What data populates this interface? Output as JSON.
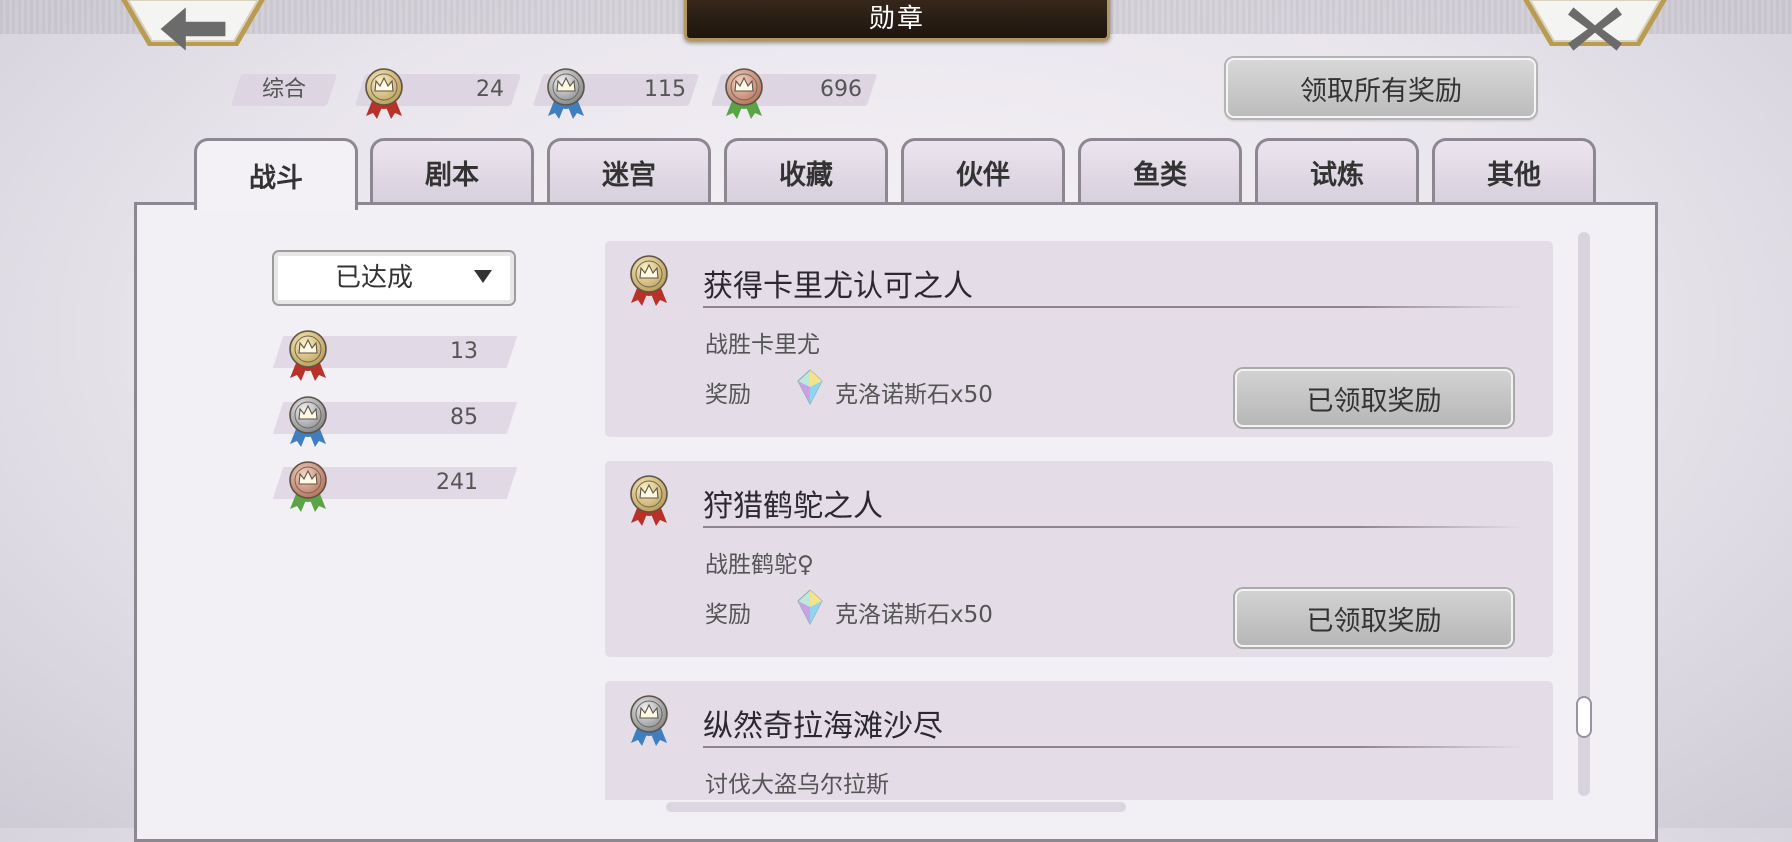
{
  "header": {
    "title": "勋章",
    "back_glyph": "🡐",
    "close_glyph": "✕"
  },
  "summary": {
    "label": "综合",
    "gold_count": "24",
    "silver_count": "115",
    "bronze_count": "696"
  },
  "claim_all_label": "领取所有奖励",
  "tabs": [
    {
      "label": "战斗",
      "active": true
    },
    {
      "label": "剧本"
    },
    {
      "label": "迷宫"
    },
    {
      "label": "收藏"
    },
    {
      "label": "伙伴"
    },
    {
      "label": "鱼类"
    },
    {
      "label": "试炼"
    },
    {
      "label": "其他"
    }
  ],
  "filter": {
    "selected": "已达成"
  },
  "category_counts": {
    "gold": "13",
    "silver": "85",
    "bronze": "241"
  },
  "reward_label": "奖励",
  "achievements": [
    {
      "medal": "gold",
      "title": "获得卡里尤认可之人",
      "description": "战胜卡里尤",
      "reward": "克洛诺斯石x50",
      "button": "已领取奖励"
    },
    {
      "medal": "gold",
      "title": "狩猎鹤鸵之人",
      "description": "战胜鹤鸵♀",
      "reward": "克洛诺斯石x50",
      "button": "已领取奖励"
    },
    {
      "medal": "silver",
      "title": "纵然奇拉海滩沙尽",
      "description": "讨伐大盗乌尔拉斯"
    }
  ],
  "colors": {
    "gold_medal": "#d8c07a",
    "silver_medal": "#a7a9ad",
    "bronze_medal": "#d6a089",
    "red_ribbon": "#b8322a",
    "blue_ribbon": "#3f7fc0",
    "green_ribbon": "#5aa446",
    "panel_border": "#8c8790",
    "title_plate": "#2a1d13"
  },
  "icons": {
    "back": "arrow-left-icon",
    "close": "close-icon",
    "dropdown": "caret-down-icon",
    "reward": "chronos-stone-icon",
    "medal": "medal-icon"
  }
}
